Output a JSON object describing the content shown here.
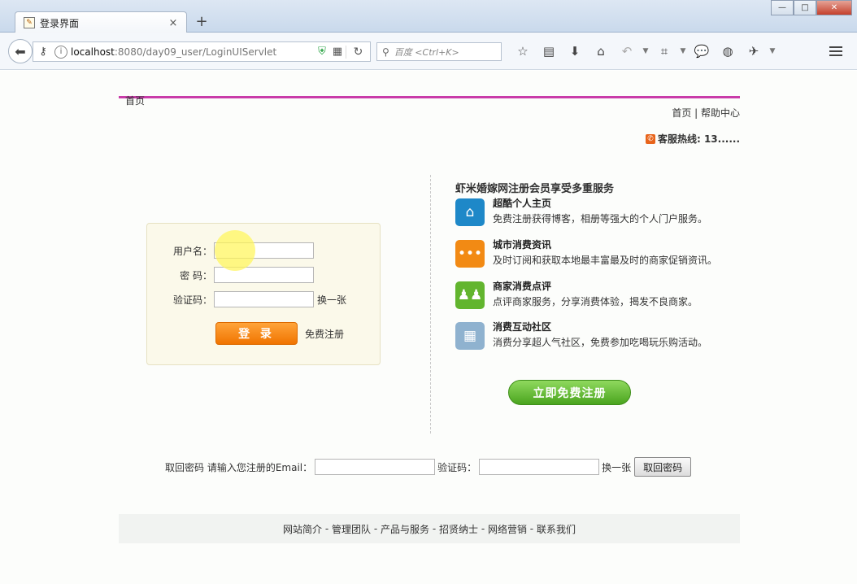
{
  "browser": {
    "tab_title": "登录界面",
    "tab_close": "×",
    "new_tab": "+",
    "url_host": "localhost",
    "url_rest": ":8080/day09_user/LoginUIServlet",
    "search_placeholder": "百度 <Ctrl+K>",
    "window_buttons": {
      "minimize": "—",
      "maximize": "□",
      "close": "✕"
    }
  },
  "header": {
    "home_text": "首页",
    "top_links": "首页 | 帮助中心",
    "hotline": "客服热线: 13......"
  },
  "login_form": {
    "username_label": "用户名：",
    "password_label": "密 码：",
    "captcha_label": "验证码：",
    "refresh_captcha": "换一张",
    "submit_label": "登 录",
    "register_link": "免费注册",
    "username_value": "",
    "password_value": "",
    "captcha_value": ""
  },
  "promo": {
    "title": "虾米婚嫁网注册会员享受多重服务",
    "features": [
      {
        "title": "超酷个人主页",
        "desc": "免费注册获得博客，相册等强大的个人门户服务。",
        "icon": "house-icon",
        "color": "#1e88c8",
        "glyph": "⌂"
      },
      {
        "title": "城市消费资讯",
        "desc": "及时订阅和获取本地最丰富最及时的商家促销资讯。",
        "icon": "chat-bubble-icon",
        "color": "#f28a14",
        "glyph": "•••"
      },
      {
        "title": "商家消费点评",
        "desc": "点评商家服务，分享消费体验，揭发不良商家。",
        "icon": "people-icon",
        "color": "#62b52e",
        "glyph": "♟♟"
      },
      {
        "title": "消费互动社区",
        "desc": "消费分享超人气社区，免费参加吃喝玩乐购活动。",
        "icon": "building-icon",
        "color": "#8fb2cf",
        "glyph": "▦"
      }
    ],
    "register_button": "立即免费注册"
  },
  "recover": {
    "prompt": "取回密码 请输入您注册的Email：",
    "email_value": "",
    "captcha_label": "验证码：",
    "captcha_value": "",
    "refresh_captcha": "换一张",
    "submit_label": "取回密码"
  },
  "footer": {
    "links": [
      "网站简介",
      "管理团队",
      "产品与服务",
      "招贤纳士",
      "网络营销",
      "联系我们"
    ],
    "separator": " - "
  }
}
